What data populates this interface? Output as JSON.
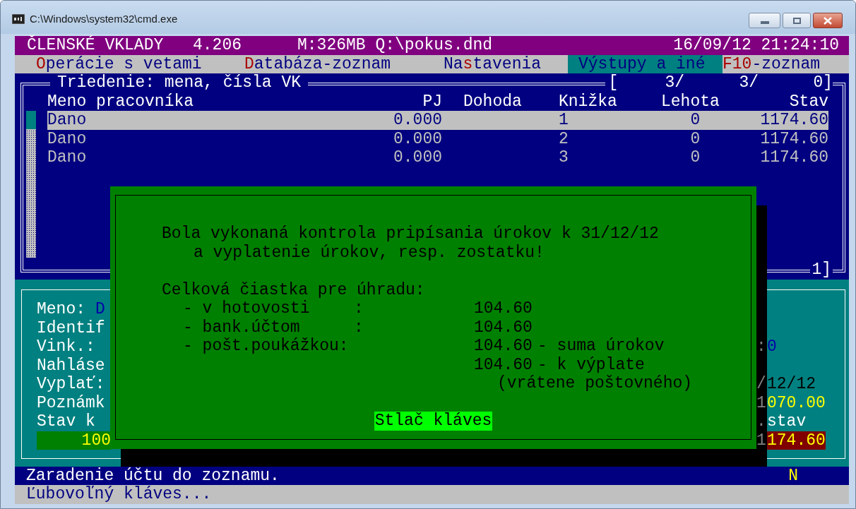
{
  "window": {
    "title": "C:\\Windows\\system32\\cmd.exe"
  },
  "header": {
    "app": "ČLENSKÉ VKLADY",
    "version": "4.206",
    "memory": "M:326MB Q:\\pokus.dnd",
    "datetime": "16/09/12 21:24:10"
  },
  "menu": [
    {
      "hotkey": "O",
      "after": "perácie s vetami",
      "selected": false
    },
    {
      "hotkey": "D",
      "after": "atabáza-zoznam",
      "selected": false
    },
    {
      "before": "Na",
      "hotkey": "s",
      "after": "tavenia",
      "selected": false
    },
    {
      "before": "Výstupy a iné",
      "selected": true
    },
    {
      "hotkey": "F10",
      "after": "-zoznam",
      "selected": false
    }
  ],
  "list": {
    "title": "Triedenie: mena, čísla VK",
    "position": [
      "[",
      "3/",
      "3/",
      "0]"
    ],
    "page": "1]",
    "columns": [
      "Meno pracovníka",
      "PJ",
      "Dohoda",
      "Knižka",
      "Lehota",
      "Stav"
    ],
    "rows": [
      {
        "name": "Dano",
        "pj": "0.000",
        "book": "1",
        "term": "0",
        "balance": "1174.60",
        "selected": true
      },
      {
        "name": "Dano",
        "pj": "0.000",
        "book": "2",
        "term": "0",
        "balance": "1174.60",
        "selected": false
      },
      {
        "name": "Dano",
        "pj": "0.000",
        "book": "3",
        "term": "0",
        "balance": "1174.60",
        "selected": false
      }
    ]
  },
  "detail": {
    "fields": [
      {
        "kind": "label",
        "label": "Meno:",
        "value": "D"
      },
      {
        "kind": "label",
        "label": "Identif"
      },
      {
        "kind": "label",
        "label": "Vink.:",
        "right": {
          "shaded": ":",
          "text": "0",
          "kind": "blue"
        }
      },
      {
        "kind": "label",
        "label": "Nahláse"
      },
      {
        "kind": "label",
        "label": "Vyplať:",
        "right": {
          "shaded": "/",
          "text": "12/12",
          "kind": "dark"
        }
      },
      {
        "kind": "label",
        "label": "Poznámk",
        "right": {
          "shaded": "1",
          "text": "070.00",
          "kind": "yellow"
        }
      },
      {
        "kind": "label",
        "label": "Stav k",
        "right": {
          "shaded": ".",
          "text": "stav",
          "kind": "white"
        }
      },
      {
        "kind": "bar",
        "label": "100",
        "right": {
          "shaded": "1",
          "text": "174.60",
          "kind": "alert"
        }
      }
    ]
  },
  "dialog": {
    "lines": [
      "Bola vykonaná kontrola pripísania úrokov k 31/12/12",
      "a vyplatenie úrokov, resp. zostatku!"
    ],
    "total_label": "Celková čiastka pre úhradu:",
    "payments": [
      {
        "label": "- v hotovosti",
        "colon": ":",
        "amount": "104.60"
      },
      {
        "label": "- bank.účtom",
        "colon": ":",
        "amount": "104.60"
      },
      {
        "label": "- pošt.poukážkou:",
        "amount": "104.60",
        "note": "- suma úrokov"
      },
      {
        "amount": "104.60",
        "note": "- k výplate"
      }
    ],
    "remark": "(vrátene poštovného)",
    "button": "Stlač kláves"
  },
  "status": {
    "message": "Zaradenie účtu do zoznamu.",
    "flag": "N"
  },
  "prompt": "Ľubovoľný kláves..."
}
